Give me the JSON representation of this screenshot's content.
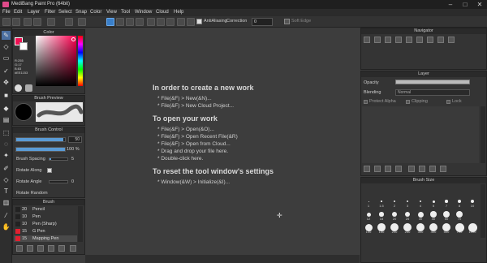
{
  "window": {
    "title": "MediBang Paint Pro (64bit)"
  },
  "menu": [
    "File",
    "Edit",
    "Layer",
    "Filter",
    "Select",
    "Snap",
    "Color",
    "View",
    "Tool",
    "Window",
    "Cloud",
    "Help"
  ],
  "toolbar": {
    "antialiasing_label": "AntiAliasing",
    "correction_label": "Correction",
    "correction_value": "0",
    "soft_edge_label": "Soft Edge"
  },
  "panels": {
    "color": "Color",
    "brush_preview": "Brush Preview",
    "brush_control": "Brush Control",
    "brush": "Brush",
    "navigator": "Navigator",
    "layer": "Layer",
    "brush_size": "Brush Size"
  },
  "color_panel": {
    "lines": [
      "R:255",
      "G:17",
      "B:83",
      "#EE1153"
    ]
  },
  "brush_control": {
    "size_value": "50",
    "opacity_value": "100 %",
    "spacing_label": "Brush Spacing",
    "spacing_value": "5",
    "rotate_along_label": "Rotate Along",
    "rotate_angle_label": "Rotate Angle",
    "rotate_angle_value": "0",
    "rotate_random_label": "Rotate Random"
  },
  "brush_list": [
    {
      "size": "20",
      "name": "Pencil",
      "color": "#222222"
    },
    {
      "size": "10",
      "name": "Pen",
      "color": "#222222"
    },
    {
      "size": "10",
      "name": "Pen (Sharp)",
      "color": "#222222"
    },
    {
      "size": "15",
      "name": "G Pen",
      "color": "#e02030"
    },
    {
      "size": "15",
      "name": "Mapping Pen",
      "color": "#e02030"
    }
  ],
  "canvas_help": {
    "h1": "In order to create a new work",
    "l1": [
      "* File(&F) > New(&N)...",
      "* File(&F) > New Cloud Project..."
    ],
    "h2": "To open your work",
    "l2": [
      "* File(&F) > Open(&O)...",
      "* File(&F) > Open Recent File(&R)",
      "* File(&F) > Open from Cloud...",
      "* Drag and drop your file here.",
      "* Double-click here."
    ],
    "h3": "To reset the tool window's settings",
    "l3": [
      "* Window(&W) > Initialize(&I)..."
    ]
  },
  "layer_panel": {
    "opacity_label": "Opacity",
    "blending_label": "Blending",
    "blending_value": "Normal",
    "protect_alpha": "Protect Alpha",
    "clipping": "Clipping",
    "lock": "Lock"
  },
  "brush_sizes": [
    [
      "",
      "",
      "",
      "",
      "",
      "",
      "",
      "",
      ""
    ],
    [
      "1",
      "1.5",
      "2",
      "3",
      "4",
      "5",
      "7",
      "8",
      "10"
    ],
    [
      "12",
      "15",
      "20",
      "25",
      "30",
      "40",
      "50",
      "70",
      ""
    ],
    [
      "100",
      "150",
      "200",
      "250",
      "300",
      "400",
      "500",
      "700",
      "1000"
    ]
  ],
  "colors": {
    "accent": "#3a7fc9",
    "panel": "#343434",
    "canvas": "#3d3d3d",
    "fg": "#ee1153"
  }
}
